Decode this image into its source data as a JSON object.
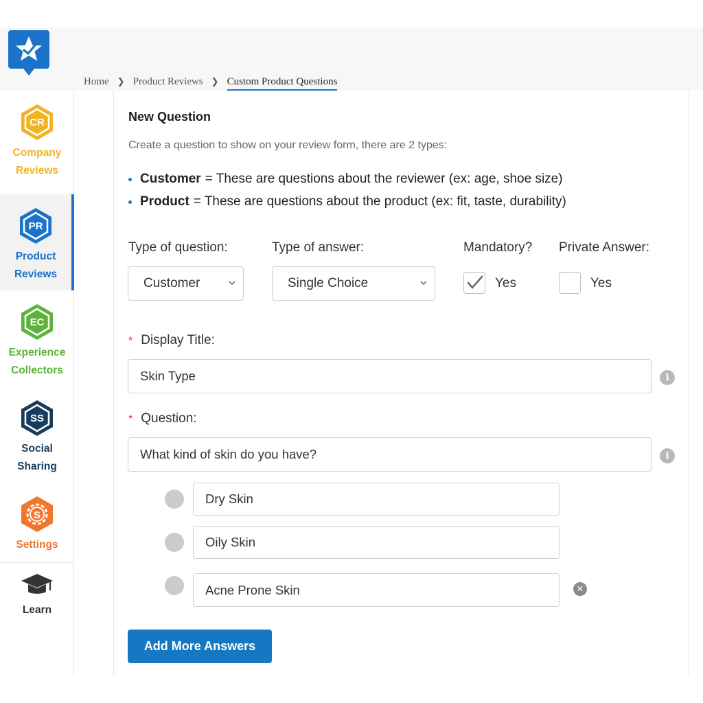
{
  "breadcrumb": {
    "home": "Home",
    "product_reviews": "Product Reviews",
    "current": "Custom Product Questions"
  },
  "sidebar": {
    "items": [
      {
        "badge": "CR",
        "label": "Company Reviews",
        "color": "#f0b323"
      },
      {
        "badge": "PR",
        "label": "Product Reviews",
        "color": "#1a73c9"
      },
      {
        "badge": "EC",
        "label": "Experience Collectors",
        "color": "#5db33a"
      },
      {
        "badge": "SS",
        "label": "Social Sharing",
        "color": "#183c5c"
      },
      {
        "badge": "S",
        "label": "Settings",
        "color": "#f0762a"
      },
      {
        "badge": "",
        "label": "Learn",
        "color": "#333333"
      }
    ]
  },
  "form": {
    "title": "New Question",
    "subtitle": "Create a question to show on your review form, there are 2 types:",
    "bullets": [
      {
        "term": "Customer",
        "text": "= These are questions about the reviewer (ex: age, shoe size)"
      },
      {
        "term": "Product",
        "text": "= These are questions about the product (ex: fit, taste, durability)"
      }
    ],
    "type_of_question_label": "Type of question:",
    "type_of_question_value": "Customer",
    "type_of_answer_label": "Type of answer:",
    "type_of_answer_value": "Single Choice",
    "mandatory_label": "Mandatory?",
    "mandatory_option": "Yes",
    "mandatory_checked": true,
    "private_label": "Private Answer:",
    "private_option": "Yes",
    "private_checked": false,
    "required_mark": "*",
    "display_title_label": "Display Title:",
    "display_title_value": "Skin Type",
    "question_label": "Question:",
    "question_value": "What kind of skin do you have?",
    "answers": [
      "Dry Skin",
      "Oily Skin",
      "Acne Prone Skin"
    ],
    "add_button": "Add More Answers"
  },
  "colors": {
    "accent": "#1a73c9",
    "button": "#1677c2",
    "required": "#e03a2f"
  }
}
